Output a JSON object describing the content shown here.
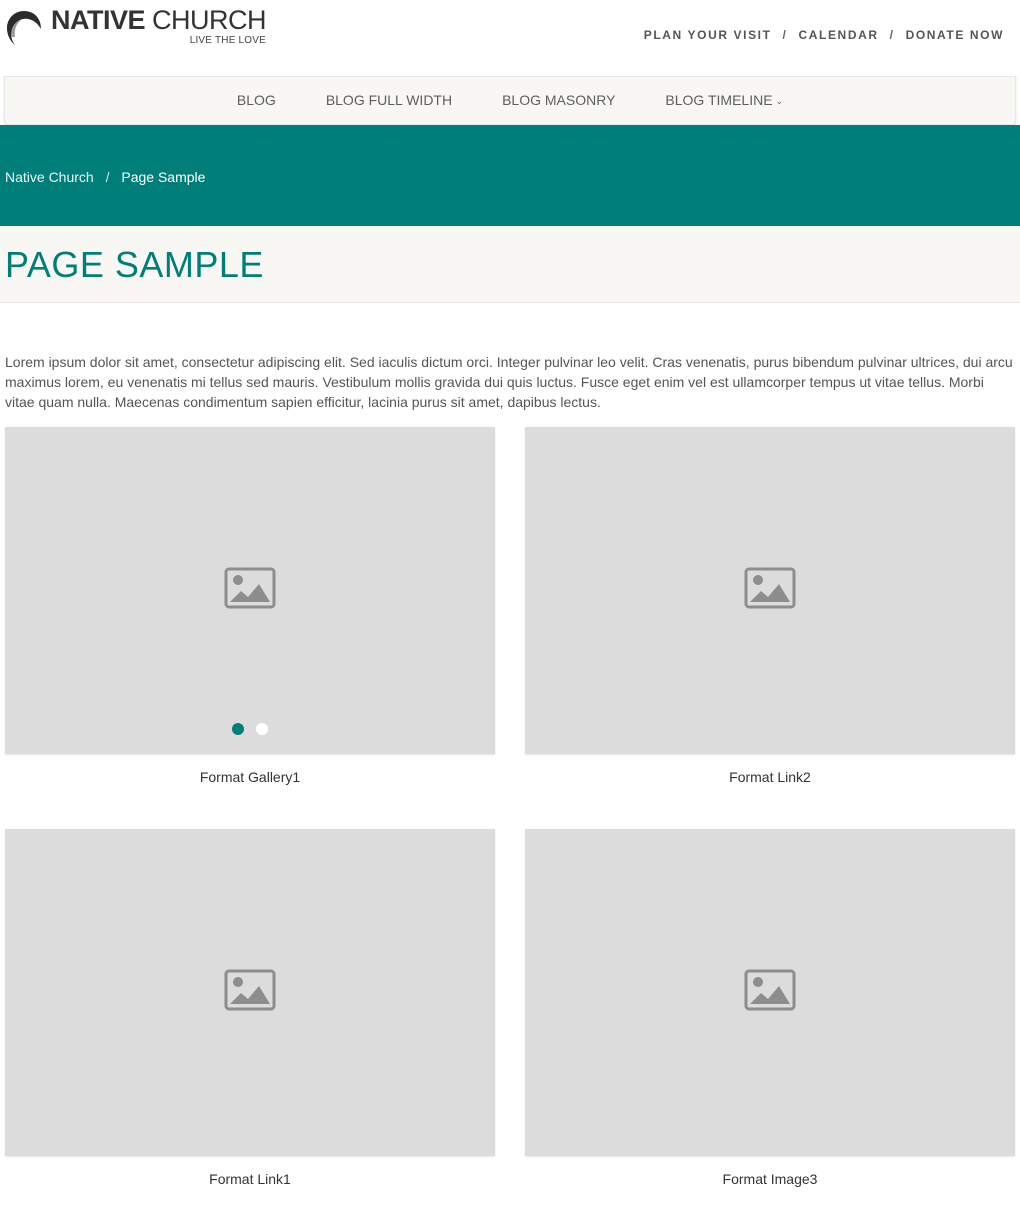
{
  "brand": {
    "title_bold": "NATIVE",
    "title_light": "CHURCH",
    "tagline": "LIVE THE LOVE"
  },
  "top_nav": [
    {
      "label": "PLAN YOUR VISIT"
    },
    {
      "label": "CALENDAR"
    },
    {
      "label": "DONATE NOW"
    }
  ],
  "top_nav_separator": "/",
  "main_menu": [
    {
      "label": "BLOG"
    },
    {
      "label": "BLOG FULL WIDTH"
    },
    {
      "label": "BLOG MASONRY"
    },
    {
      "label": "BLOG TIMELINE",
      "has_dropdown": true
    }
  ],
  "breadcrumb": {
    "home": "Native Church",
    "separator": "/",
    "current": "Page Sample"
  },
  "page_title": "PAGE SAMPLE",
  "intro_text": "Lorem ipsum dolor sit amet, consectetur adipiscing elit. Sed iaculis dictum orci. Integer pulvinar leo velit. Cras venenatis, purus bibendum pulvinar ultrices, dui arcu maximus lorem, eu venenatis mi tellus sed mauris. Vestibulum mollis gravida dui quis luctus. Fusce eget enim vel est ullamcorper tempus ut vitae tellus. Morbi vitae quam nulla. Maecenas condimentum sapien efficitur, lacinia purus sit amet, dapibus lectus.",
  "posts": [
    {
      "caption": "Format Gallery1",
      "icon": "image-placeholder-icon",
      "slider_dots": 2,
      "active_dot": 1
    },
    {
      "caption": "Format Link2",
      "icon": "image-placeholder-icon"
    },
    {
      "caption": "Format Link1",
      "icon": "image-placeholder-icon"
    },
    {
      "caption": "Format Image3",
      "icon": "image-placeholder-icon"
    }
  ],
  "colors": {
    "accent": "#007f7a",
    "placeholder_bg": "#dcdcdc",
    "light_band": "#f8f7f3"
  }
}
